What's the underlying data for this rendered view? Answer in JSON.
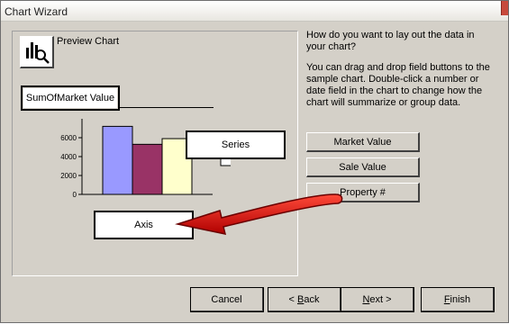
{
  "window": {
    "title": "Chart Wizard"
  },
  "preview": {
    "label": "Preview Chart",
    "data_field": "SumOfMarket Value",
    "series_field": "Series",
    "axis_field": "Axis",
    "y_ticks": [
      "6000",
      "4000",
      "2000",
      "0"
    ],
    "colors": {
      "bar1": "#9999ff",
      "bar2": "#993366",
      "bar3": "#ffffcc"
    }
  },
  "chart_data": {
    "type": "bar",
    "categories": [
      "",
      "",
      ""
    ],
    "values": [
      7200,
      5300,
      5900
    ],
    "ylim": [
      0,
      8000
    ]
  },
  "instructions": {
    "question": "How do you want to lay out the data in your chart?",
    "help": "You can drag and drop field buttons to the sample chart. Double-click a number or date field in the chart to change how the chart will summarize or group data."
  },
  "fields": [
    {
      "label": "Market Value"
    },
    {
      "label": "Sale Value"
    },
    {
      "label": "Property #"
    }
  ],
  "buttons": {
    "cancel": "Cancel",
    "back_pre": "< ",
    "back_ul": "B",
    "back_post": "ack",
    "next_ul": "N",
    "next_post": "ext >",
    "finish_ul": "F",
    "finish_post": "inish"
  },
  "annotation": {
    "arrow_color": "#e00000"
  }
}
